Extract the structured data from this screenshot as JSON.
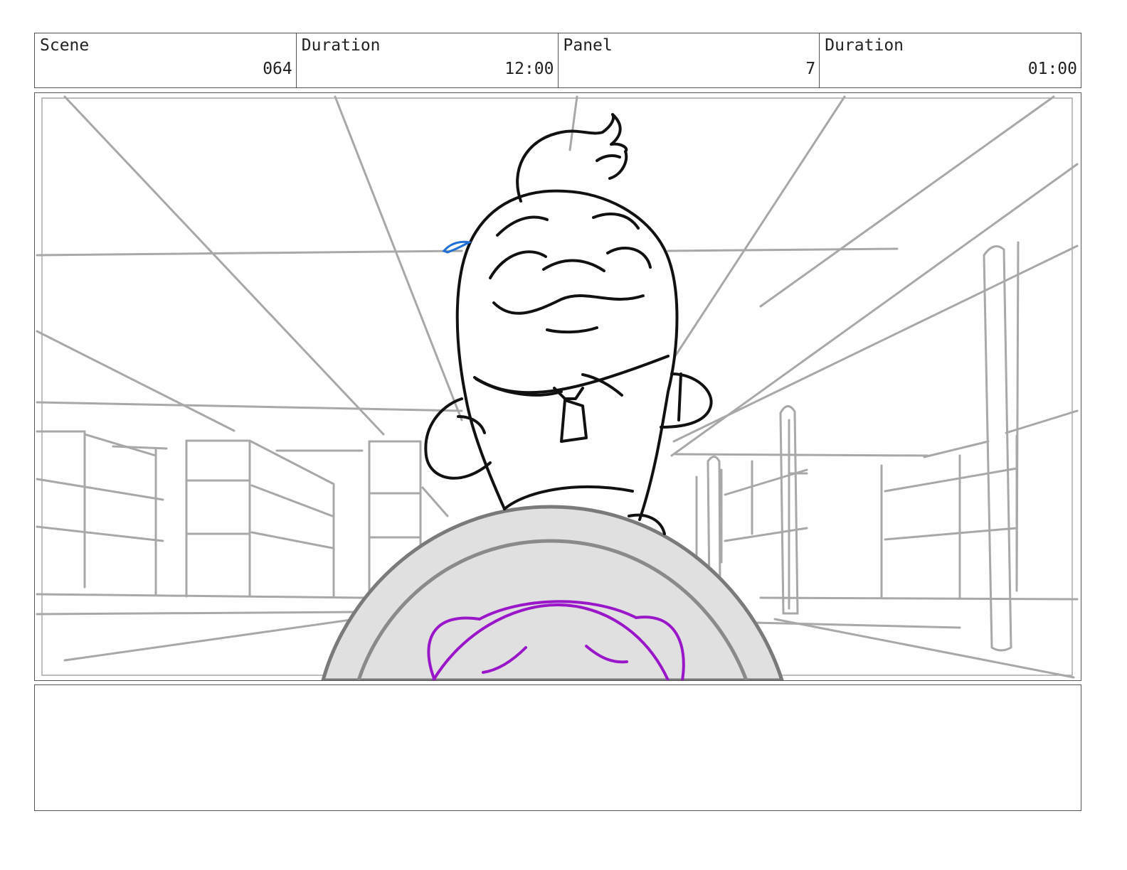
{
  "header": {
    "cells": [
      {
        "label": "Scene",
        "value": "064"
      },
      {
        "label": "Duration",
        "value": "12:00"
      },
      {
        "label": "Panel",
        "value": "7"
      },
      {
        "label": "Duration",
        "value": "01:00"
      }
    ]
  },
  "notes": {
    "text": ""
  },
  "colors": {
    "border": "#555555",
    "sketch_gray": "#a8a8a8",
    "character_line": "#111111",
    "sweat_drop": "#1f6fd6",
    "purple_character": "#9a16c9",
    "wheel_fill": "#e0e0e0"
  }
}
